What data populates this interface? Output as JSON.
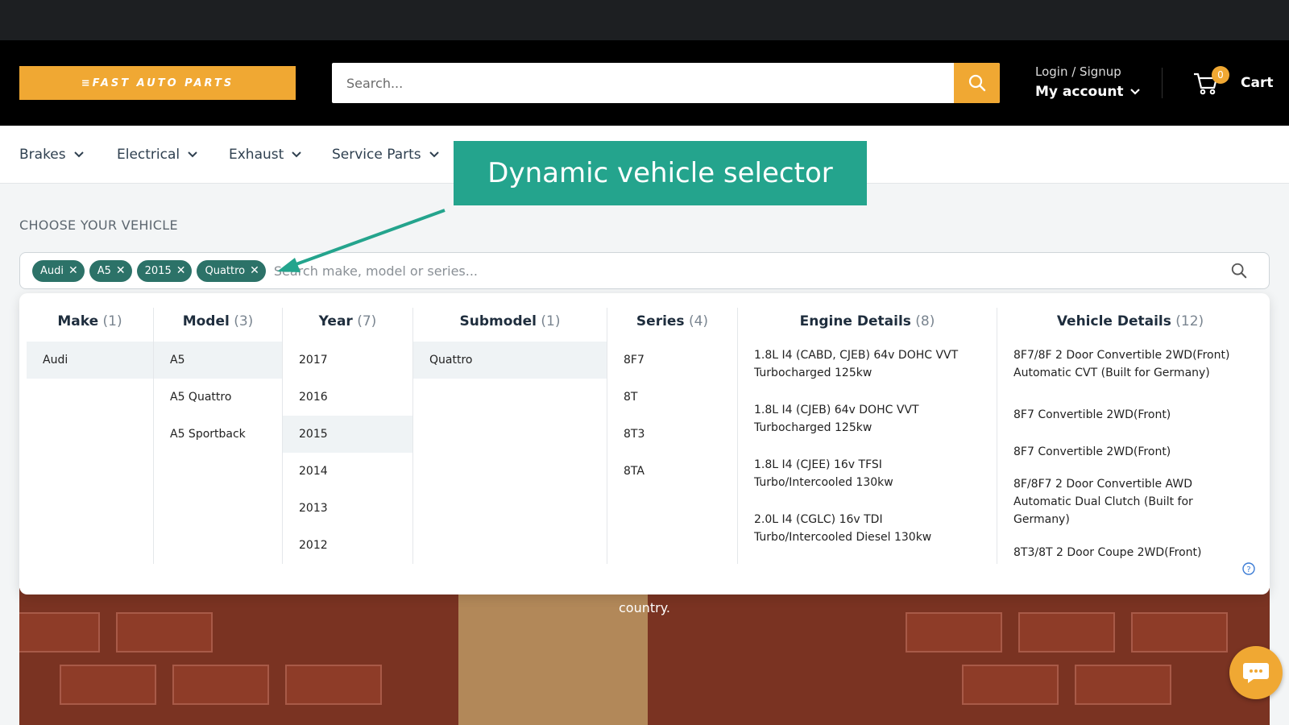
{
  "header": {
    "logo_text": "≡FAST AUTO PARTS",
    "search_placeholder": "Search...",
    "login_label": "Login / Signup",
    "account_label": "My account",
    "cart_count": "0",
    "cart_label": "Cart"
  },
  "nav": {
    "items": [
      {
        "label": "Brakes"
      },
      {
        "label": "Electrical"
      },
      {
        "label": "Exhaust"
      },
      {
        "label": "Service Parts"
      }
    ]
  },
  "callout": {
    "text": "Dynamic vehicle selector"
  },
  "selector": {
    "title": "CHOOSE YOUR VEHICLE",
    "chips": [
      "Audi",
      "A5",
      "2015",
      "Quattro"
    ],
    "placeholder": "Search make, model or series...",
    "columns": [
      {
        "title": "Make",
        "count": "(1)",
        "options": [
          "Audi"
        ],
        "selected": 0
      },
      {
        "title": "Model",
        "count": "(3)",
        "options": [
          "A5",
          "A5 Quattro",
          "A5 Sportback"
        ],
        "selected": 0
      },
      {
        "title": "Year",
        "count": "(7)",
        "options": [
          "2017",
          "2016",
          "2015",
          "2014",
          "2013",
          "2012"
        ],
        "selected": 2
      },
      {
        "title": "Submodel",
        "count": "(1)",
        "options": [
          "Quattro"
        ],
        "selected": 0
      },
      {
        "title": "Series",
        "count": "(4)",
        "options": [
          "8F7",
          "8T",
          "8T3",
          "8TA"
        ]
      },
      {
        "title": "Engine Details",
        "count": "(8)",
        "options": [
          "1.8L I4 (CABD, CJEB) 64v DOHC VVT Turbocharged 125kw",
          "1.8L I4 (CJEB) 64v DOHC VVT Turbocharged 125kw",
          "1.8L I4 (CJEE) 16v TFSI Turbo/Intercooled 130kw",
          "2.0L I4 (CGLC) 16v TDI Turbo/Intercooled Diesel 130kw"
        ]
      },
      {
        "title": "Vehicle Details",
        "count": "(12)",
        "options": [
          "8F7/8F 2 Door Convertible 2WD(Front) Automatic CVT (Built for Germany)",
          "8F7 Convertible 2WD(Front)",
          "8F7 Convertible 2WD(Front)",
          "8F/8F7 2 Door Convertible AWD Automatic Dual Clutch (Built for Germany)",
          "8T3/8T 2 Door Coupe 2WD(Front)"
        ]
      }
    ]
  },
  "hero": {
    "text": "country."
  },
  "colors": {
    "accent": "#f0a833",
    "callout": "#24a48d",
    "chip": "#2c7268"
  }
}
